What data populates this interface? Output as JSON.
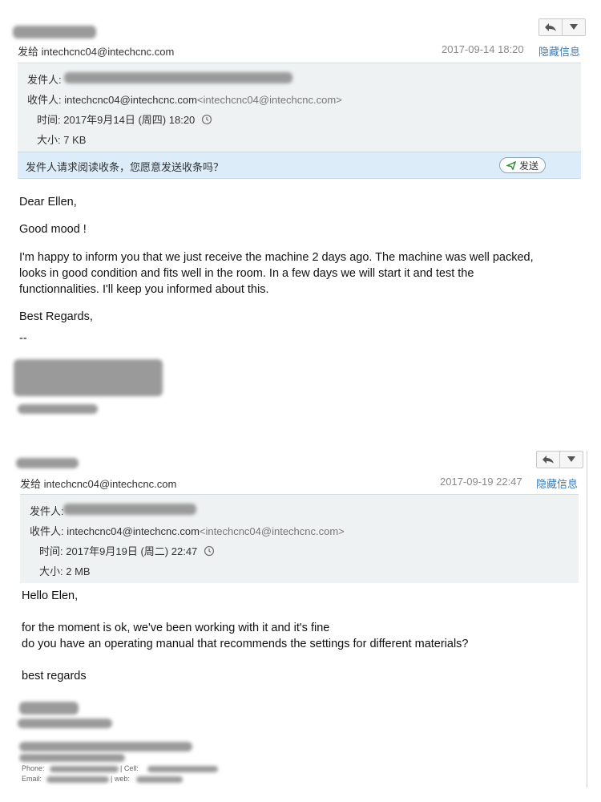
{
  "email1": {
    "to_line": "发给 intechcnc04@intechcnc.com",
    "date": "2017-09-14 18:20",
    "hide_info": "隐藏信息",
    "from_label": "发件人:",
    "recipient_label": "收件人:",
    "recipient_value": "intechcnc04@intechcnc.com",
    "recipient_bracket": "<intechcnc04@intechcnc.com>",
    "time_label": "时间:",
    "time_value": "2017年9月14日 (周四) 18:20",
    "size_label": "大小:",
    "size_value": "7 KB",
    "receipt_notice": "发件人请求阅读收条，您愿意发送收条吗？",
    "send_label": "发送",
    "body": {
      "greeting": "Dear Ellen,",
      "line1": "Good mood !",
      "para1_l1": "I'm happy to inform you that we just receive the machine 2 days ago. The machine was well packed,",
      "para1_l2": "looks in good condition  and fits well in the room. In a few days we will start it and test the",
      "para1_l3": "functionnalities. I'll keep you informed about this.",
      "closing": "Best Regards,",
      "sig_sep": "--"
    }
  },
  "email2": {
    "to_line": "发给 intechcnc04@intechcnc.com",
    "date": "2017-09-19 22:47",
    "hide_info": "隐藏信息",
    "from_label": "发件人:",
    "recipient_label": "收件人:",
    "recipient_value": "intechcnc04@intechcnc.com",
    "recipient_bracket": "<intechcnc04@intechcnc.com>",
    "time_label": "时间:",
    "time_value": "2017年9月19日 (周二) 22:47",
    "size_label": "大小:",
    "size_value": "2 MB",
    "body": {
      "greeting": "Hello Elen,",
      "line1": "for the moment is ok, we've been working with it and it's fine",
      "line2": "do you have an operating manual that recommends the settings for different materials?",
      "closing": "best regards",
      "sig_phone": "Phone:",
      "sig_cell": "| Cell:",
      "sig_email": "Email:",
      "sig_web": "| web:"
    }
  },
  "icons": {
    "reply": "reply-icon",
    "dropdown": "chevron-down-icon",
    "clock": "clock-icon",
    "send": "send-icon"
  }
}
